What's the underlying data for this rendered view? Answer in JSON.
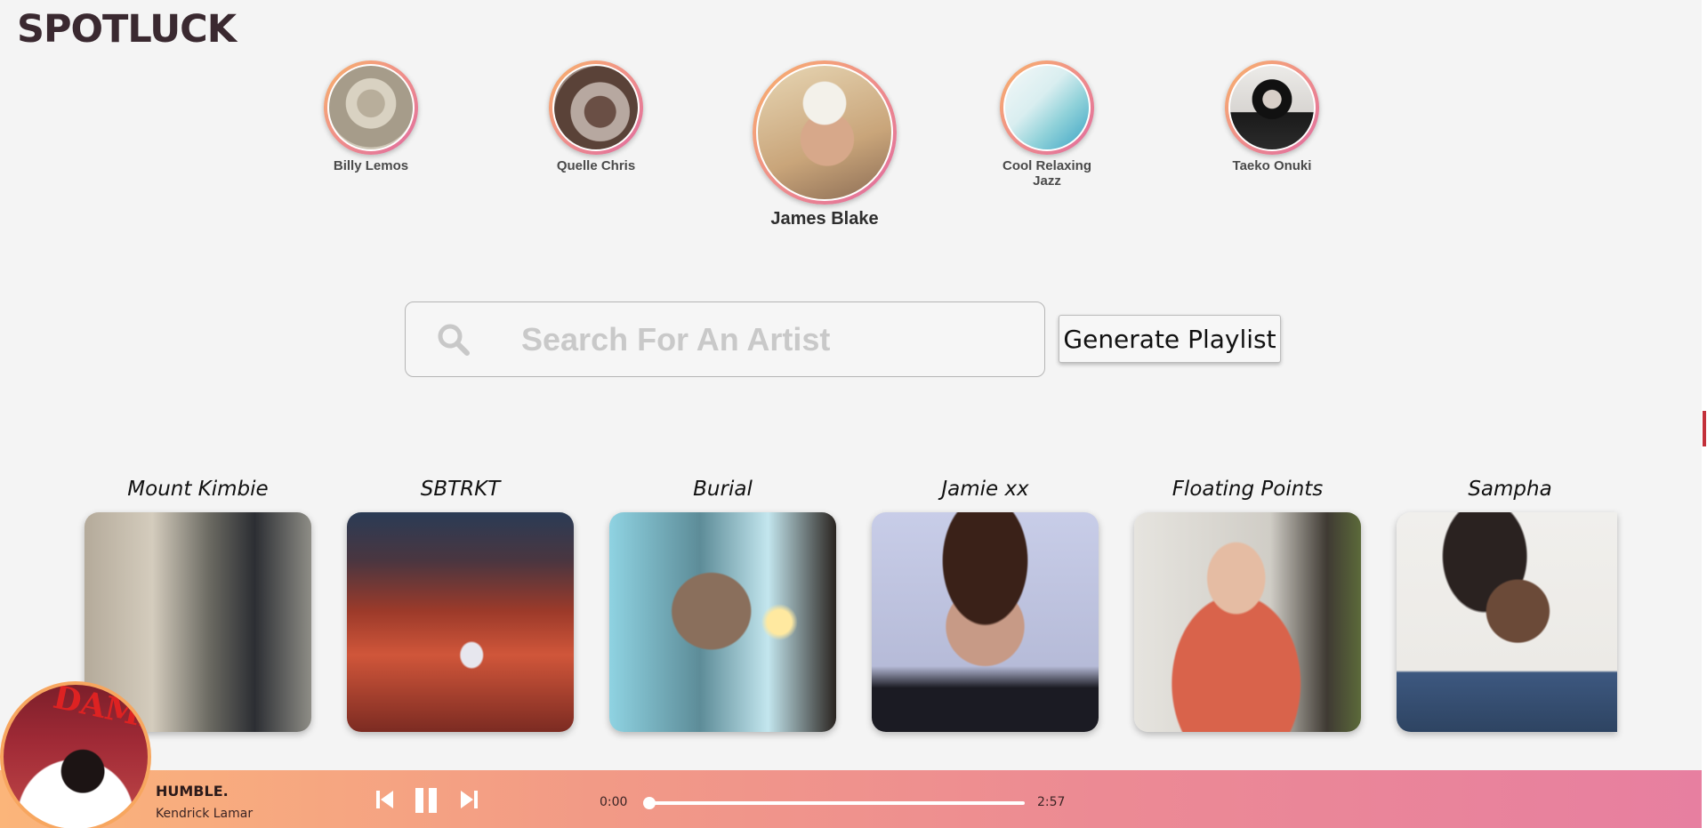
{
  "app": {
    "title": "SPOTLUCK"
  },
  "history": [
    {
      "name": "Billy Lemos",
      "img": "sepia",
      "colors": [
        "#cfc8b8",
        "#9a8f80",
        "#5b5146"
      ]
    },
    {
      "name": "Quelle Chris",
      "img": "smoke",
      "colors": [
        "#b7a8a0",
        "#6a4f45",
        "#2e2320"
      ]
    },
    {
      "name": "James Blake",
      "img": "portrait",
      "colors": [
        "#d9c4a3",
        "#c9a57a",
        "#8c6d55"
      ],
      "current": true
    },
    {
      "name": "Cool Relaxing Jazz",
      "img": "aerial",
      "colors": [
        "#eaf3f4",
        "#8fd1d9",
        "#3aa2c4"
      ]
    },
    {
      "name": "Taeko Onuki",
      "img": "bw",
      "colors": [
        "#e9e6e3",
        "#8f8a86",
        "#111111"
      ]
    }
  ],
  "search": {
    "placeholder": "Search For An Artist",
    "value": ""
  },
  "generate_button": {
    "label": "Generate Playlist"
  },
  "related": [
    {
      "name": "Mount Kimbie",
      "colors": [
        "#c8c0b1",
        "#7b7566",
        "#2c2e33"
      ]
    },
    {
      "name": "SBTRKT",
      "colors": [
        "#2a3b55",
        "#9c3a2a",
        "#d0563a"
      ]
    },
    {
      "name": "Burial",
      "colors": [
        "#8fd3e2",
        "#3a4b54",
        "#1a1410"
      ]
    },
    {
      "name": "Jamie xx",
      "colors": [
        "#c8cde8",
        "#a8867a",
        "#1b1b23"
      ]
    },
    {
      "name": "Floating Points",
      "colors": [
        "#e6e4df",
        "#d9634b",
        "#3f3a33"
      ]
    },
    {
      "name": "Sampha",
      "colors": [
        "#f0efec",
        "#6b4a38",
        "#3d5880"
      ]
    }
  ],
  "player": {
    "track": "HUMBLE.",
    "artist": "Kendrick Lamar",
    "album_letters": "DAMN",
    "elapsed": "0:00",
    "duration": "2:57",
    "progress": 0.0,
    "colors": {
      "start": "#fbb57a",
      "end": "#e77fa0"
    }
  }
}
